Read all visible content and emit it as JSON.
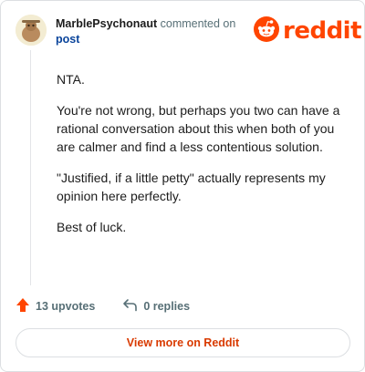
{
  "header": {
    "username": "MarblePsychonaut",
    "action": "commented on",
    "post_link": "post"
  },
  "brand": {
    "logo_text": "reddit",
    "logo_icon": "reddit-alien-icon",
    "color": "#ff4500"
  },
  "comment": {
    "paragraphs": [
      "NTA.",
      "You're not wrong, but perhaps you two can have a rational conversation about this when both of you are calmer and find a less contentious solution.",
      "\"Justified, if a little petty\" actually represents my opinion here perfectly.",
      "Best of luck."
    ]
  },
  "footer": {
    "upvotes": "13 upvotes",
    "upvote_icon": "upvote-arrow-icon",
    "replies": "0 replies",
    "reply_icon": "reply-arrow-icon"
  },
  "cta": {
    "label": "View more on Reddit",
    "color": "#d93a00"
  }
}
